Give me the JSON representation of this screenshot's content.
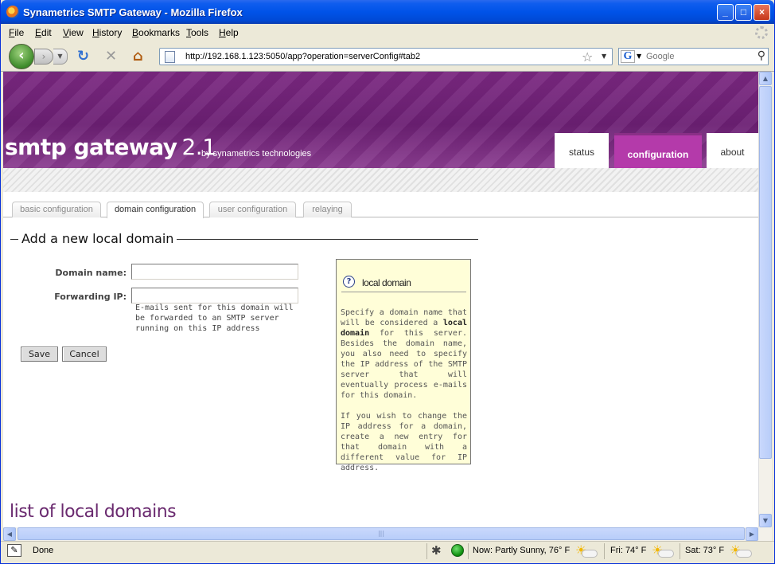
{
  "window": {
    "title": "Synametrics SMTP Gateway - Mozilla Firefox",
    "controls": {
      "minimize": "_",
      "maximize": "□",
      "close": "×"
    }
  },
  "menu": [
    "File",
    "Edit",
    "View",
    "History",
    "Bookmarks",
    "Tools",
    "Help"
  ],
  "nav": {
    "url": "http://192.168.1.123:5050/app?operation=serverConfig#tab2",
    "search_placeholder": "Google",
    "search_engine_letter": "G"
  },
  "header": {
    "logo": "smtp gateway",
    "version": "2.1",
    "byline": "by synametrics technologies",
    "tabs": [
      "status",
      "configuration",
      "about"
    ],
    "active_tab": "configuration"
  },
  "subtabs": [
    "basic configuration",
    "domain configuration",
    "user configuration",
    "relaying"
  ],
  "active_subtab": "domain configuration",
  "form": {
    "legend": "Add a new local domain",
    "domain_label": "Domain name:",
    "domain_value": "",
    "forwarding_label": "Forwarding IP:",
    "forwarding_value": "",
    "forwarding_help": "E-mails sent for this domain will be forwarded to an SMTP server running on this IP address",
    "save_label": "Save",
    "cancel_label": "Cancel"
  },
  "help": {
    "title": "local domain",
    "para1_pre": "Specify a domain name that will be considered a ",
    "para1_bold": "local domain",
    "para1_post": " for this server. Besides the domain name, you also need to specify the IP address of the SMTP server that will eventually process e-mails for this domain.",
    "para2": "If you wish to change the IP address for a domain, create a new entry for that domain with a different value for IP address."
  },
  "section_title": "list of local domains",
  "status": {
    "text": "Done",
    "weather_now": "Now: Partly Sunny, 76° F",
    "weather_fri": "Fri: 74° F",
    "weather_sat": "Sat: 73° F"
  },
  "colors": {
    "brand_purple": "#6b1f73",
    "active_tab": "#b43aaa",
    "help_bg": "#fffed8"
  }
}
